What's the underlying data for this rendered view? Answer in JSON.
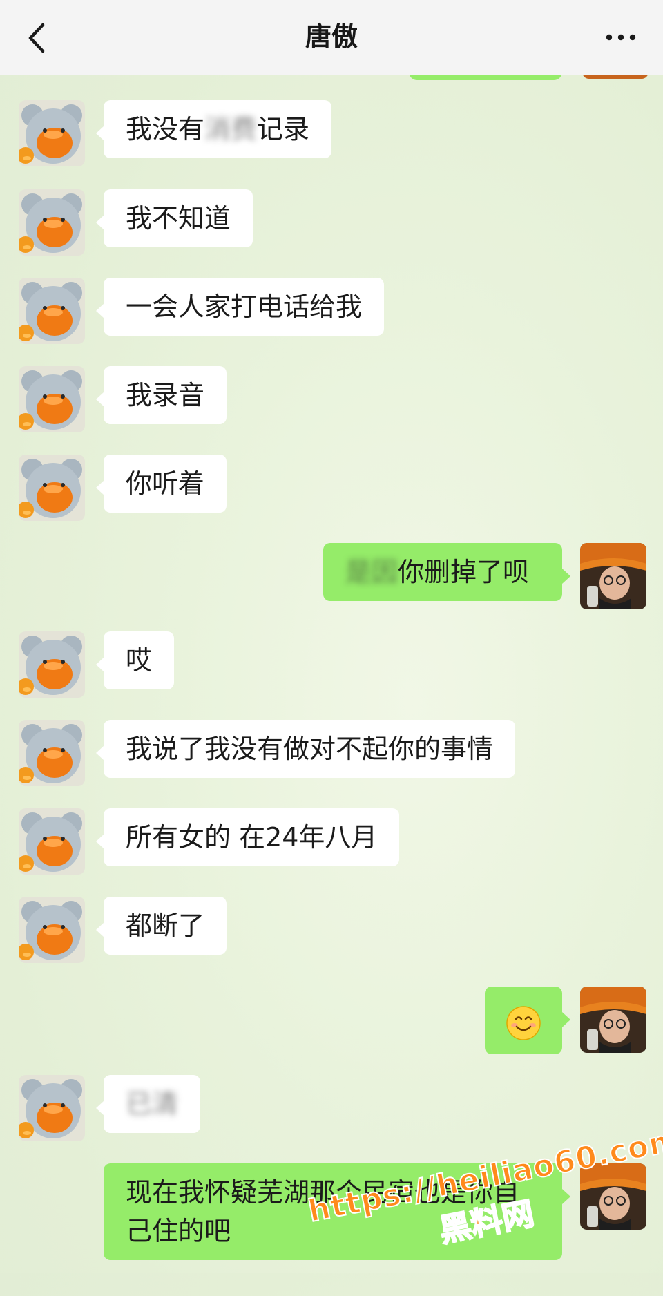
{
  "header": {
    "title": "唐傲",
    "back_icon": "chevron-left-icon",
    "more_icon": "more-horizontal-icon"
  },
  "messages": [
    {
      "side": "in",
      "text": "我没有消费记录"
    },
    {
      "side": "in",
      "text": "我不知道"
    },
    {
      "side": "in",
      "text": "一会人家打电话给我"
    },
    {
      "side": "in",
      "text": "我录音"
    },
    {
      "side": "in",
      "text": "你听着"
    },
    {
      "side": "out",
      "text_blurred": "是因",
      "text": "你删掉了呗"
    },
    {
      "side": "in",
      "text": "哎"
    },
    {
      "side": "in",
      "text": "我说了我没有做对不起你的事情"
    },
    {
      "side": "in",
      "text": "所有女的 在24年八月"
    },
    {
      "side": "in",
      "text": "都断了"
    },
    {
      "side": "out",
      "emoji": "smile-emoji"
    },
    {
      "side": "in",
      "text": "已清"
    },
    {
      "side": "out",
      "text_line1": "现在我怀疑芜湖那个民宿也是你自",
      "text_line2": "己住的吧"
    }
  ],
  "watermark": {
    "url": "https://heiliao60.com",
    "name": "黑料网"
  },
  "colors": {
    "incoming_bubble": "#ffffff",
    "outgoing_bubble": "#95ec69",
    "nav_background": "#f4f4f4",
    "watermark": "#ff8a1c"
  }
}
